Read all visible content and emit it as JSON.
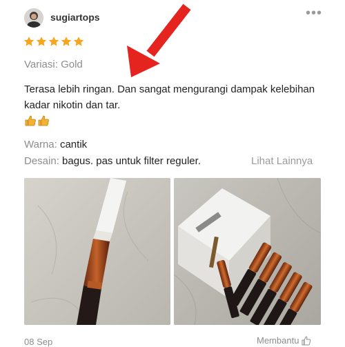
{
  "review": {
    "username": "sugiartops",
    "rating_stars": 5,
    "variation": "Variasi: Gold",
    "text": "Terasa lebih ringan. Dan sangat mengurangi dampak kelebihan kadar nikotin dan tar.",
    "emoji": "👍👍",
    "attributes": [
      {
        "label": "Warna:",
        "value": "cantik"
      },
      {
        "label": "Desain:",
        "value": "bagus. pas untuk filter reguler."
      }
    ],
    "see_more": "Lihat Lainnya",
    "date": "08 Sep",
    "helpful_label": "Membantu"
  },
  "colors": {
    "star": "#f5a623",
    "annotation_arrow": "#e52420",
    "muted_text": "#8d8d8d"
  },
  "icons": {
    "more": "more-dots-icon",
    "helpful": "thumbs-up-icon",
    "emoji": "thumbs-up-emoji-icon"
  }
}
